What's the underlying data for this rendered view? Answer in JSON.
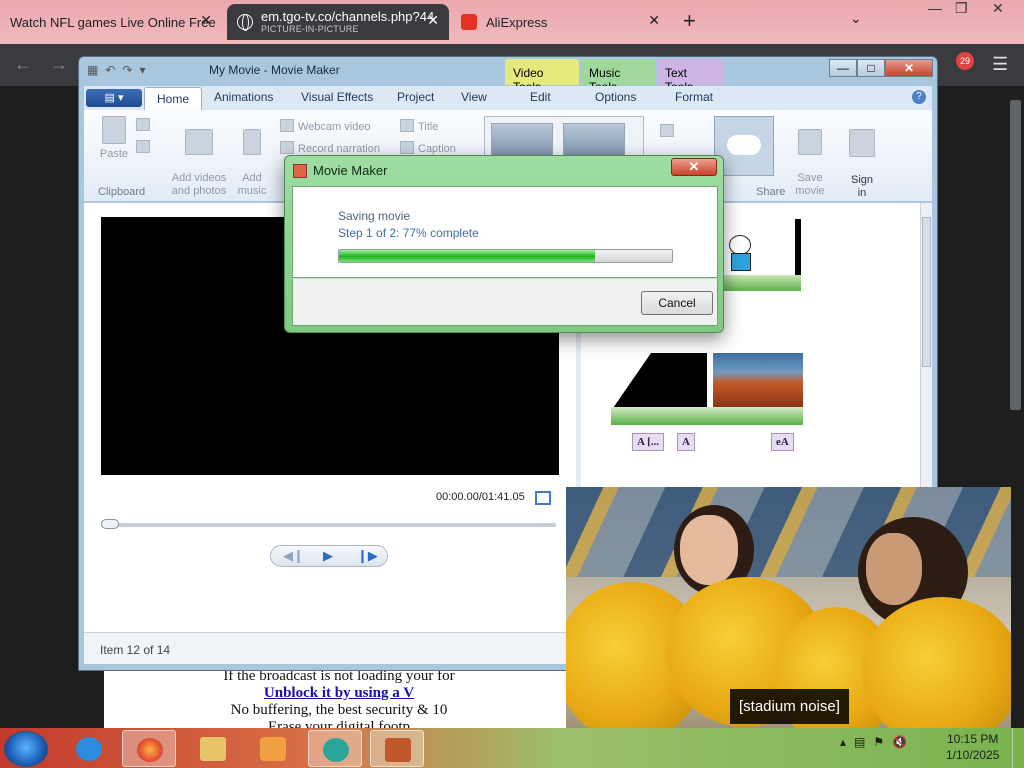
{
  "browser": {
    "tabs": [
      {
        "title": "Watch NFL games Live Online Free"
      },
      {
        "title": "em.tgo-tv.co/channels.php?44",
        "subtitle": "PICTURE-IN-PICTURE"
      },
      {
        "title": "AliExpress"
      }
    ],
    "new_tab": "+",
    "tab_close": "✕",
    "extension_badge": "29"
  },
  "webpage": {
    "line1": "If the broadcast is not loading your for",
    "link": "Unblock it by using a V",
    "line3": "No buffering, the best security & 10",
    "line4": "Erase your digital footp"
  },
  "moviemaker": {
    "window_title": "My Movie - Movie Maker",
    "context_tabs": [
      "Video Tools",
      "Music Tools",
      "Text Tools"
    ],
    "ribbon_tabs": [
      "Home",
      "Animations",
      "Visual Effects",
      "Project",
      "View",
      "Edit",
      "Options",
      "Format"
    ],
    "ribbon": {
      "paste": "Paste",
      "clipboard_group": "Clipboard",
      "add_videos": "Add videos\nand photos",
      "add_music": "Add\nmusic",
      "webcam": "Webcam video",
      "record_narration": "Record narration",
      "title": "Title",
      "caption": "Caption",
      "save_movie": "Save\nmovie",
      "sign_in": "Sign\nin",
      "share_group": "Share"
    },
    "timecode": "00:00.00/01:41.05",
    "status": "Item 12 of 14",
    "caption_boxes": [
      "A [...",
      "A",
      "eA"
    ]
  },
  "dialog": {
    "title": "Movie Maker",
    "line1": "Saving movie",
    "line2": "Step 1 of 2: 77% complete",
    "progress": 0.77,
    "cancel": "Cancel",
    "close": "✕"
  },
  "pip": {
    "caption": "[stadium noise]"
  },
  "taskbar": {
    "time": "10:15 PM",
    "date": "1/10/2025"
  },
  "colors": {
    "progress": "#1fb11f",
    "tab_active": "#3a3b3f",
    "tabbar": "#f0b9bd"
  }
}
